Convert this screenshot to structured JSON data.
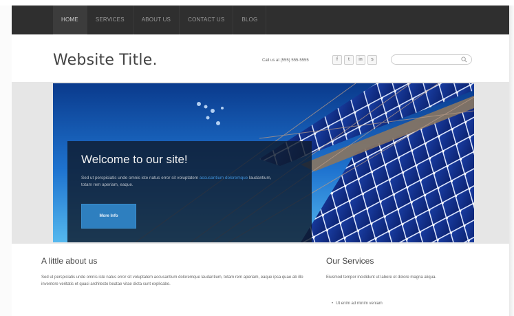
{
  "nav": {
    "items": [
      {
        "label": "HOME",
        "active": true
      },
      {
        "label": "SERVICES",
        "active": false
      },
      {
        "label": "ABOUT US",
        "active": false
      },
      {
        "label": "CONTACT US",
        "active": false
      },
      {
        "label": "BLOG",
        "active": false
      }
    ]
  },
  "header": {
    "site_title": "Website Title.",
    "call_text": "Call us at (555) 555-5555",
    "social_icons": [
      {
        "name": "facebook-icon",
        "glyph": "f"
      },
      {
        "name": "twitter-icon",
        "glyph": "t"
      },
      {
        "name": "linkedin-icon",
        "glyph": "in"
      },
      {
        "name": "skype-icon",
        "glyph": "s"
      }
    ],
    "search_placeholder": ""
  },
  "hero": {
    "title": "Welcome to our site!",
    "text_part1": "Sed ut perspiciatis unde omnis iste natus error sit voluptatem",
    "text_link": "accusantium doloremque",
    "text_part2": "laudantium, totam rem aperiam, eaque.",
    "button_label": "More Info"
  },
  "about": {
    "heading": "A little about us",
    "text": "Sed ut perspiciatis unde omnis iste natus error sit voluptatem accusantium doloremque laudantium, totam rem aperiam, eaque ipsa quae ab illo inventore veritatis et quasi architecto beatae vitae dicta sunt explicabo."
  },
  "services": {
    "heading": "Our Services",
    "text": "Eiusmod tempor incididunt ut labore et dolore magna aliqua.",
    "items": [
      "Ut enim ad minim veniam"
    ]
  },
  "colors": {
    "nav_bg": "#2f2f2f",
    "accent_blue": "#2e7fbf",
    "overlay": "#0f1b2d"
  }
}
